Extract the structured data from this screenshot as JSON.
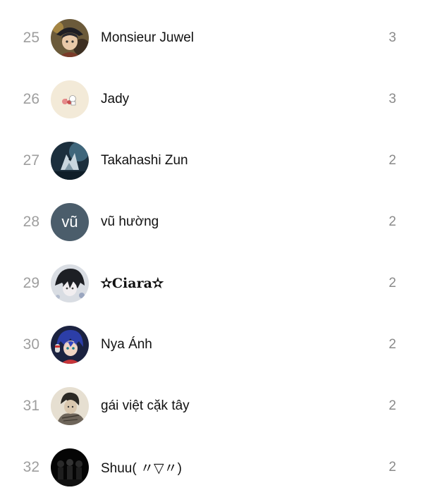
{
  "rows": [
    {
      "rank": "25",
      "name": "Monsieur Juwel",
      "count": "3",
      "avatar": "anime-boy-hat-avatar"
    },
    {
      "rank": "26",
      "name": "Jady",
      "count": "3",
      "avatar": "cute-sticker-avatar"
    },
    {
      "rank": "27",
      "name": "Takahashi Zun",
      "count": "2",
      "avatar": "dark-wolf-avatar"
    },
    {
      "rank": "28",
      "name": "vũ hường",
      "count": "2",
      "avatar_text": "vũ",
      "avatar_color": "#4b5d6b"
    },
    {
      "rank": "29",
      "name": "✫Ciara✫",
      "count": "2",
      "avatar": "anime-bw-avatar"
    },
    {
      "rank": "30",
      "name": "Nya Ánh",
      "count": "2",
      "avatar": "anime-headphones-avatar"
    },
    {
      "rank": "31",
      "name": "gái việt cặk tây",
      "count": "2",
      "avatar": "manga-sketch-avatar"
    },
    {
      "rank": "32",
      "name": "Shuu( 〃▽〃)",
      "count": "2",
      "avatar": "dark-group-avatar"
    }
  ]
}
